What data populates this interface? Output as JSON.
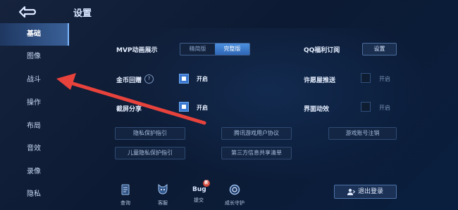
{
  "header": {
    "title": "设置"
  },
  "sidebar": {
    "items": [
      {
        "label": "基础",
        "active": true
      },
      {
        "label": "图像"
      },
      {
        "label": "战斗"
      },
      {
        "label": "操作"
      },
      {
        "label": "布局"
      },
      {
        "label": "音效"
      },
      {
        "label": "录像"
      },
      {
        "label": "隐私"
      }
    ]
  },
  "settings": {
    "mvp": {
      "label": "MVP动画展示",
      "options": [
        "精简版",
        "完整版"
      ],
      "selected": "完整版"
    },
    "qq_welfare": {
      "label": "QQ福利订阅",
      "button": "设置"
    },
    "gold_share": {
      "label": "金币回赠",
      "state": "开启"
    },
    "wish_push": {
      "label": "许愿屋推送",
      "state": "开启"
    },
    "screenshot_share": {
      "label": "截屏分享",
      "state": "开启"
    },
    "ui_anim": {
      "label": "界面动效",
      "state": "开启"
    }
  },
  "links": {
    "privacy_guide": "隐私保护指引",
    "user_agreement": "腾讯游戏用户协议",
    "account_cancel": "游戏账号注销",
    "child_privacy": "儿童隐私保护指引",
    "third_party": "第三方信息共享清单"
  },
  "bottom": {
    "query": "查询",
    "service": "客服",
    "bug_icon_text": "Bug",
    "bug_badge": "新",
    "bug": "提交",
    "growth": "成长守护",
    "logout": "退出登录"
  },
  "colors": {
    "accent": "#3a78d0",
    "background": "#0c1a33",
    "annotation_arrow": "#e8423c"
  }
}
